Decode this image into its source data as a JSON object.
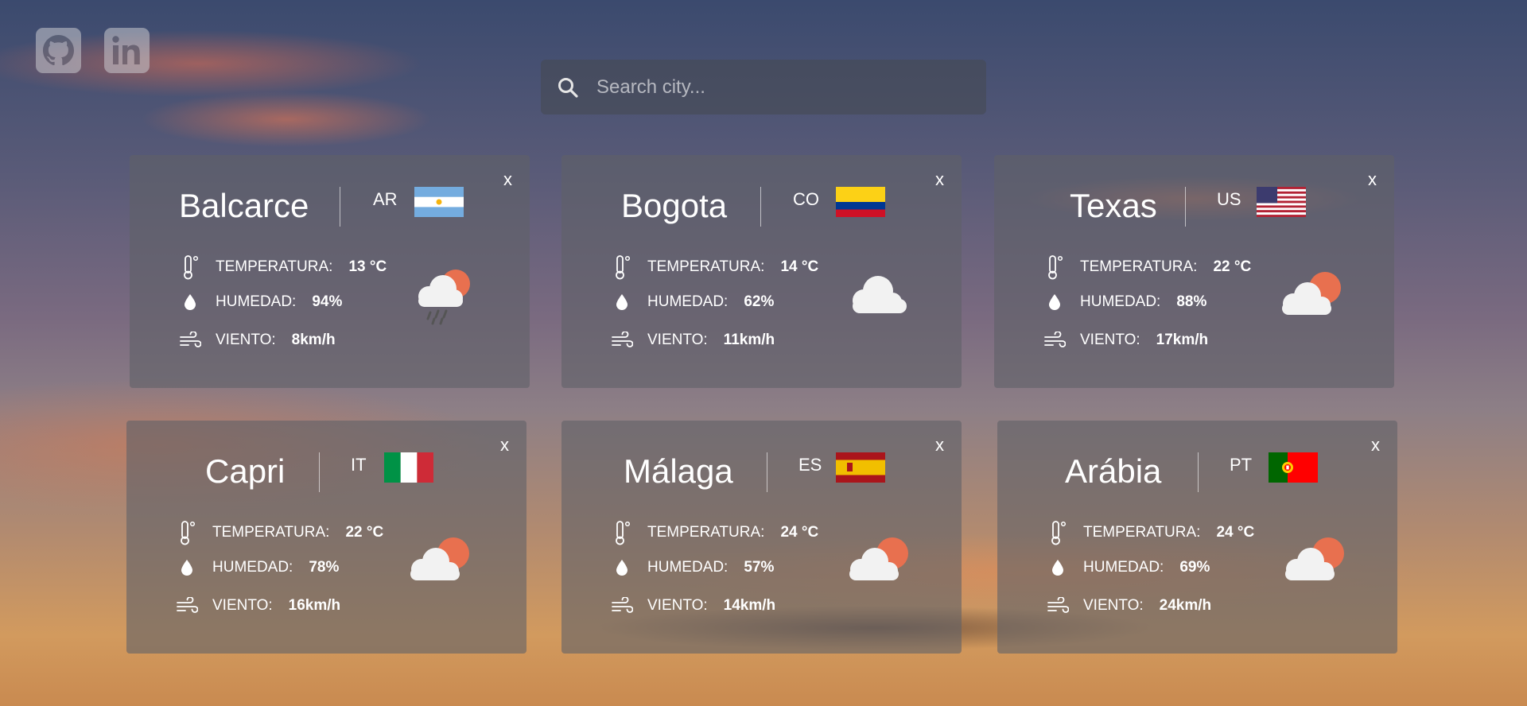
{
  "search": {
    "placeholder": "Search city..."
  },
  "labels": {
    "temp": "TEMPERATURA:",
    "hum": "HUMEDAD:",
    "wind": "VIENTO:",
    "close": "x"
  },
  "cards": [
    {
      "city": "Balcarce",
      "code": "AR",
      "temp": "13 °C",
      "hum": "94%",
      "wind": "8km/h",
      "weather": "rain-cloud-sun-icon"
    },
    {
      "city": "Bogota",
      "code": "CO",
      "temp": "14 °C",
      "hum": "62%",
      "wind": "11km/h",
      "weather": "cloud-icon"
    },
    {
      "city": "Texas",
      "code": "US",
      "temp": "22 °C",
      "hum": "88%",
      "wind": "17km/h",
      "weather": "cloud-sun-icon"
    },
    {
      "city": "Capri",
      "code": "IT",
      "temp": "22 °C",
      "hum": "78%",
      "wind": "16km/h",
      "weather": "cloud-sun-icon"
    },
    {
      "city": "Málaga",
      "code": "ES",
      "temp": "24 °C",
      "hum": "57%",
      "wind": "14km/h",
      "weather": "cloud-sun-icon"
    },
    {
      "city": "Arábia",
      "code": "PT",
      "temp": "24 °C",
      "hum": "69%",
      "wind": "24km/h",
      "weather": "cloud-sun-icon"
    }
  ],
  "colors": {
    "sun": "#e8704f",
    "cloud": "#f2f2f2",
    "card_bg": "rgba(95,96,104,0.6)"
  }
}
